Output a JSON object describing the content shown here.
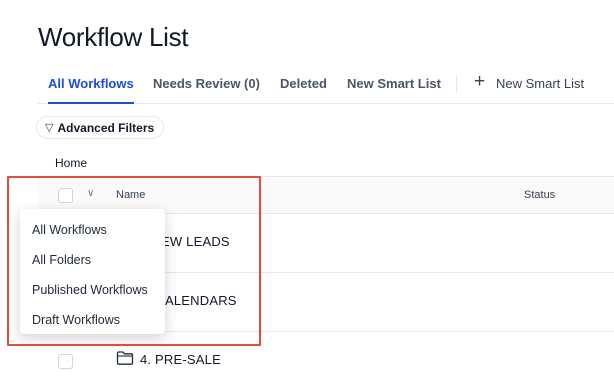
{
  "page": {
    "title": "Workflow List"
  },
  "tabs": [
    {
      "label": "All Workflows",
      "active": true
    },
    {
      "label": "Needs Review (0)",
      "active": false
    },
    {
      "label": "Deleted",
      "active": false
    },
    {
      "label": "New Smart List",
      "active": false
    }
  ],
  "new_smart_list": {
    "icon": "plus-icon",
    "label": "New Smart List"
  },
  "filters": {
    "label": "Advanced Filters",
    "icon": "filter-icon"
  },
  "breadcrumb": {
    "home": "Home"
  },
  "table": {
    "columns": {
      "name": "Name",
      "status": "Status"
    },
    "rows": [
      {
        "name": "EW LEADS",
        "icon": "folder-icon"
      },
      {
        "name": "ALENDARS",
        "icon": "folder-icon"
      },
      {
        "name": "4. PRE-SALE",
        "icon": "folder-icon"
      }
    ]
  },
  "dropdown": {
    "items": [
      {
        "label": "All Workflows"
      },
      {
        "label": "All Folders"
      },
      {
        "label": "Published Workflows"
      },
      {
        "label": "Draft Workflows"
      }
    ]
  },
  "colors": {
    "accent": "#1d4ed8",
    "highlight": "#e54a3c"
  }
}
